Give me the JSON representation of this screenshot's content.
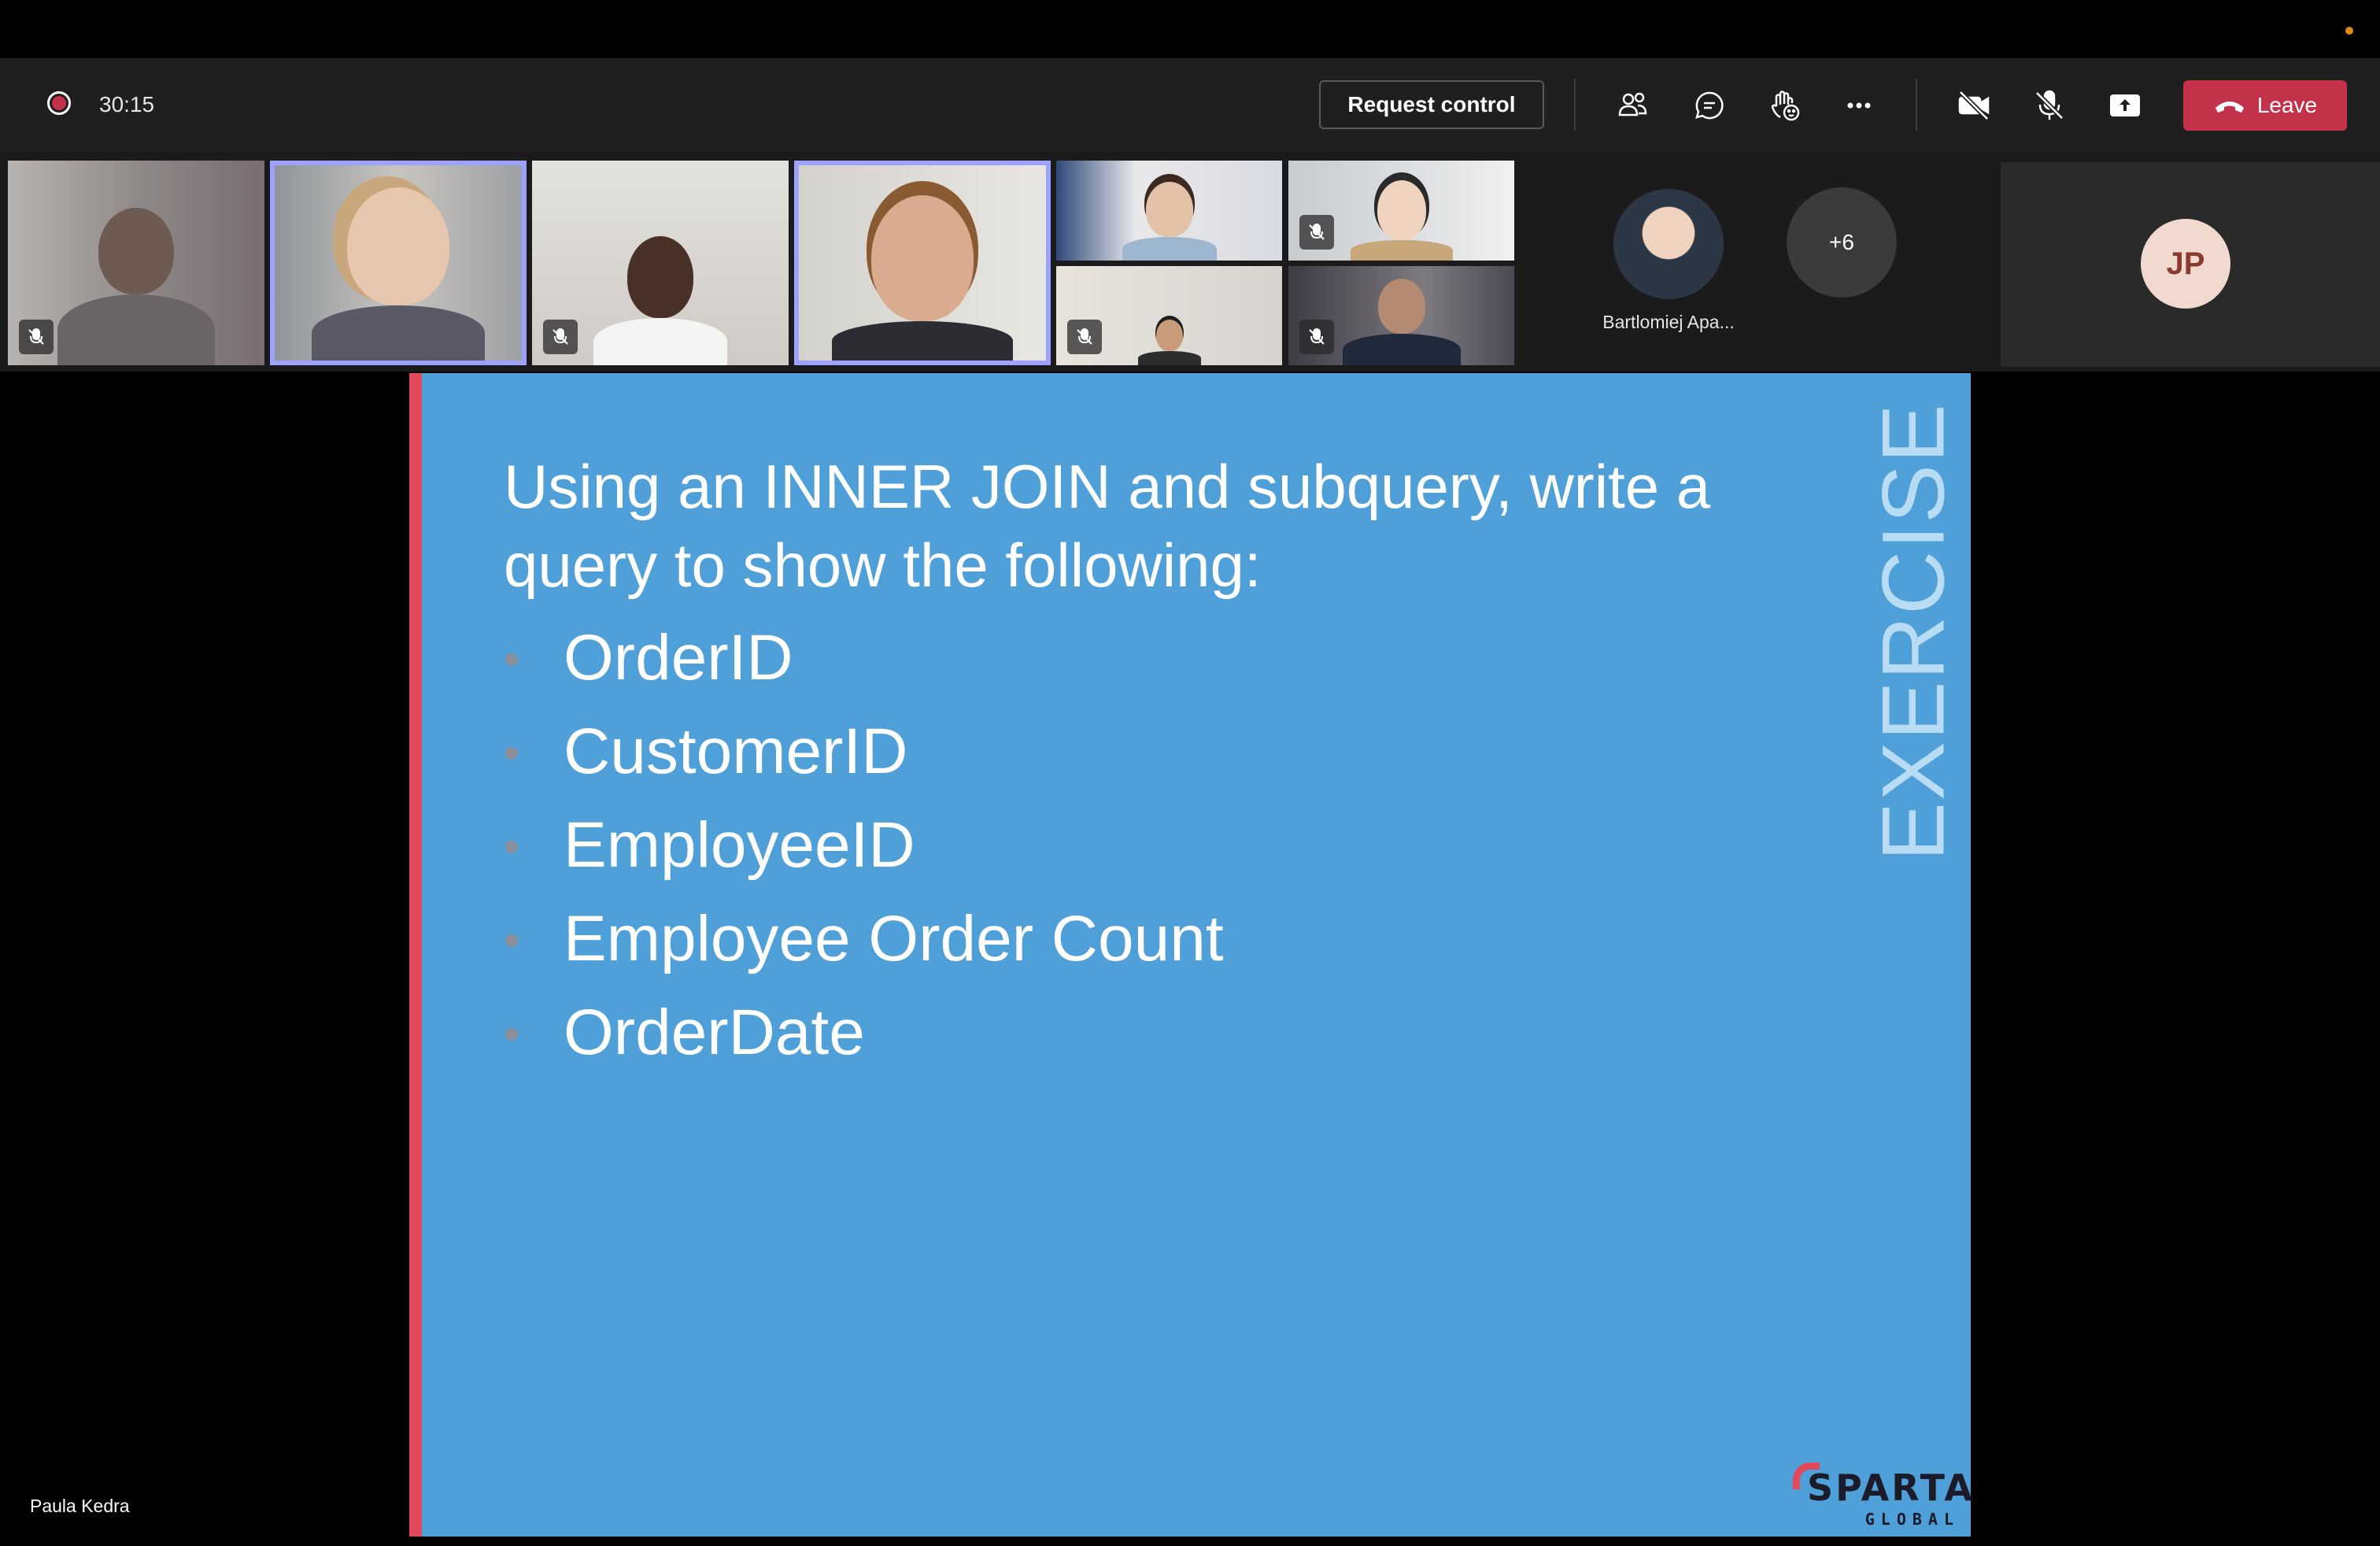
{
  "meeting": {
    "elapsed": "30:15"
  },
  "toolbar": {
    "request_control_label": "Request control",
    "leave_label": "Leave",
    "icons": [
      "people-icon",
      "chat-icon",
      "raise-hand-icon",
      "more-options-icon",
      "camera-off-icon",
      "mic-off-icon",
      "share-screen-icon",
      "hang-up-icon"
    ]
  },
  "participants": {
    "featured_name": "Bartlomiej Apa...",
    "overflow_count": "+6",
    "self_initials": "JP"
  },
  "slide": {
    "title": "Using an INNER JOIN and subquery, write a query to show the following:",
    "bullets": [
      "OrderID",
      "CustomerID",
      "EmployeeID",
      "Employee Order Count",
      "OrderDate"
    ],
    "side_label": "EXERCISE",
    "logo_text": "SPARTA",
    "logo_subtext": "GLOBAL"
  },
  "presenter": {
    "name": "Paula Kedra"
  },
  "colors": {
    "slide_bg": "#4f9fd8",
    "accent_red": "#e04a5a",
    "leave_red": "#c4314b",
    "active_speaker": "#9ea2ff"
  }
}
